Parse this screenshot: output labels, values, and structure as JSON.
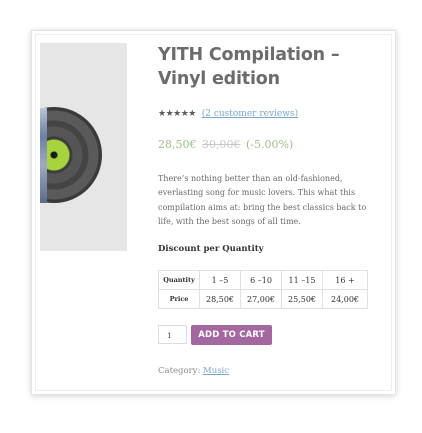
{
  "product": {
    "title": "YITH Compilation – Vinyl edition",
    "rating": {
      "stars": "★★★★★",
      "reviews_link": "(2 customer reviews)"
    },
    "price": {
      "current": "28,50€",
      "original": "30,00€",
      "discount": "(-5.00%)"
    },
    "description": "There’s nothing better than an old-fashioned, everlasting song for music lovers. This what this compilation aims at: bring the best classics back to life, with the best songs of all time.",
    "discount_table": {
      "title": "Discount per Quantity",
      "quantity_label": "Quantity",
      "price_label": "Price",
      "ranges": [
        "1 –5",
        "6 –10",
        "11 –15",
        "16 +"
      ],
      "prices": [
        "28,50€",
        "27,00€",
        "25,50€",
        "24,00€"
      ]
    },
    "quantity_value": "1",
    "add_to_cart_label": "ADD TO CART",
    "category": {
      "label": "Category:",
      "value": "Music"
    }
  },
  "colors": {
    "price_green": "#9ebf8c",
    "button_purple": "#a5679f",
    "link_blue": "#7aa7c7",
    "vinyl_label": "#a7d33c"
  }
}
